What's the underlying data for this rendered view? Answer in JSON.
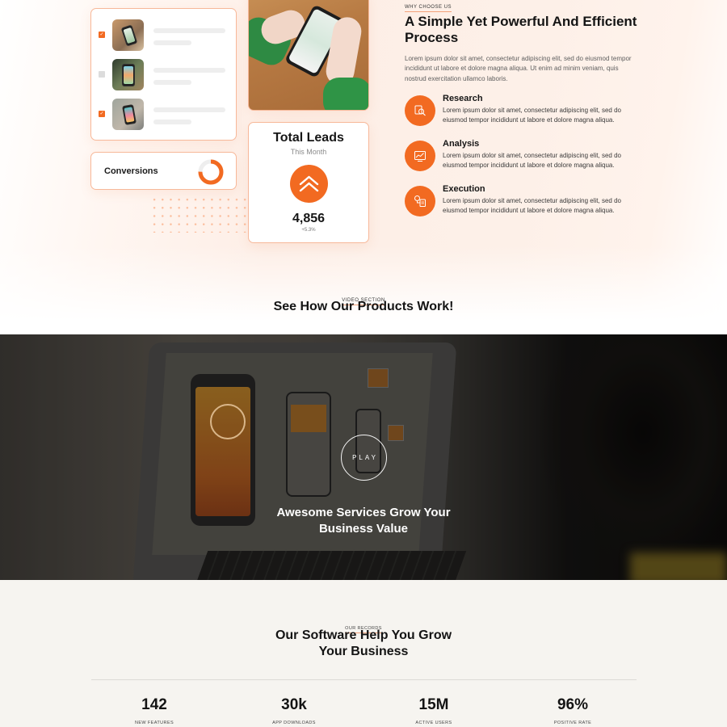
{
  "why_section": {
    "eyebrow": "WHY CHOOSE US",
    "title": "A Simple Yet Powerful And Efficient Process",
    "description": "Lorem ipsum dolor sit amet, consectetur adipiscing elit, sed do eiusmod tempor incididunt ut labore et dolore magna aliqua. Ut enim ad minim veniam, quis nostrud exercitation ullamco laboris.",
    "features": [
      {
        "title": "Research",
        "icon": "research-icon",
        "description": "Lorem ipsum dolor sit amet, consectetur adipiscing elit, sed do eiusmod tempor incididunt ut labore et dolore magna aliqua."
      },
      {
        "title": "Analysis",
        "icon": "analysis-chart-icon",
        "description": "Lorem ipsum dolor sit amet, consectetur adipiscing elit, sed do eiusmod tempor incididunt ut labore et dolore magna aliqua."
      },
      {
        "title": "Execution",
        "icon": "execution-workflow-icon",
        "description": "Lorem ipsum dolor sit amet, consectetur adipiscing elit, sed do eiusmod tempor incididunt ut labore et dolore magna aliqua."
      }
    ]
  },
  "task_list": {
    "items": [
      {
        "checked": true,
        "thumbnail": "phone-qr-photo"
      },
      {
        "checked": false,
        "thumbnail": "phone-app-photo"
      },
      {
        "checked": true,
        "thumbnail": "phone-street-photo"
      }
    ]
  },
  "conversions": {
    "label": "Conversions",
    "fill_fraction": 0.75
  },
  "total_leads": {
    "title": "Total Leads",
    "subtitle": "This Month",
    "value": "4,856",
    "delta": "+5.3%",
    "icon": "double-chevron-up-icon"
  },
  "video_section": {
    "eyebrow": "VIDEO SECTION",
    "title": "See How Our Products Work!",
    "play_label": "PLAY",
    "caption_line1": "Awesome Services Grow Your",
    "caption_line2": "Business Value"
  },
  "records": {
    "eyebrow": "OUR RECORDS",
    "title_line1": "Our Software Help You Grow",
    "title_line2": "Your Business",
    "stats": [
      {
        "value": "142",
        "label": "NEW FEATURES"
      },
      {
        "value": "30k",
        "label": "APP DOWNLOADS"
      },
      {
        "value": "15M",
        "label": "ACTIVE USERS"
      },
      {
        "value": "96%",
        "label": "POSITIVE RATE"
      }
    ]
  },
  "colors": {
    "accent": "#f26a21",
    "card_border": "#f7b899",
    "records_bg": "#f6f4f0",
    "text_dark": "#141414"
  }
}
